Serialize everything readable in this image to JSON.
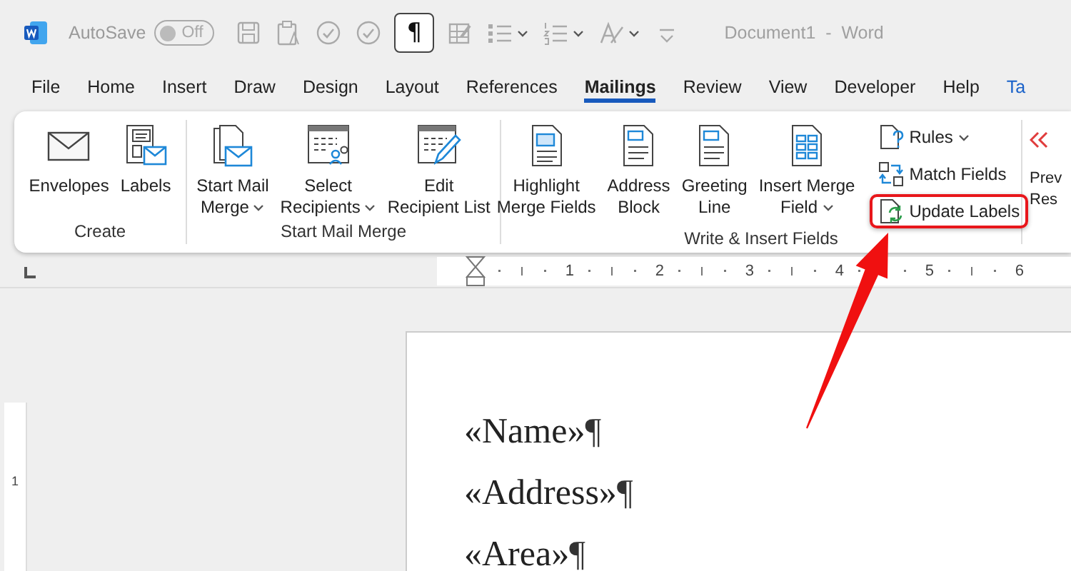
{
  "title_bar": {
    "autosave_label": "AutoSave",
    "autosave_toggle": {
      "label": "Off",
      "on": false
    },
    "tools_left": [
      {
        "kind": "save"
      },
      {
        "kind": "clipboard"
      },
      {
        "kind": "check"
      },
      {
        "kind": "check"
      }
    ],
    "show_marks": {
      "label": "¶",
      "on": true
    },
    "tools_right": [
      {
        "kind": "table",
        "menu": false
      },
      {
        "kind": "bullets",
        "menu": true
      },
      {
        "kind": "numbering",
        "menu": true
      },
      {
        "kind": "styles",
        "menu": true
      },
      {
        "kind": "customize",
        "menu": false
      }
    ],
    "window_title": "Document1  -  Word"
  },
  "tabs": [
    {
      "label": "File",
      "selected": false,
      "contextual": false
    },
    {
      "label": "Home",
      "selected": false,
      "contextual": false
    },
    {
      "label": "Insert",
      "selected": false,
      "contextual": false
    },
    {
      "label": "Draw",
      "selected": false,
      "contextual": false
    },
    {
      "label": "Design",
      "selected": false,
      "contextual": false
    },
    {
      "label": "Layout",
      "selected": false,
      "contextual": false
    },
    {
      "label": "References",
      "selected": false,
      "contextual": false
    },
    {
      "label": "Mailings",
      "selected": true,
      "contextual": false
    },
    {
      "label": "Review",
      "selected": false,
      "contextual": false
    },
    {
      "label": "View",
      "selected": false,
      "contextual": false
    },
    {
      "label": "Developer",
      "selected": false,
      "contextual": false
    },
    {
      "label": "Help",
      "selected": false,
      "contextual": false
    },
    {
      "label": "Ta",
      "selected": false,
      "contextual": true
    }
  ],
  "ribbon": {
    "groups": [
      {
        "label": "Create",
        "buttons": [
          {
            "kind": "large",
            "label": "Envelopes",
            "menu": false,
            "highlighted": false
          },
          {
            "kind": "large",
            "label": "Labels",
            "menu": false,
            "highlighted": false
          }
        ]
      },
      {
        "label": "Start Mail Merge",
        "buttons": [
          {
            "kind": "large",
            "label": "Start Mail\nMerge",
            "menu": true,
            "highlighted": false
          },
          {
            "kind": "large",
            "label": "Select\nRecipients",
            "menu": true,
            "highlighted": false
          },
          {
            "kind": "large",
            "label": "Edit\nRecipient List",
            "menu": false,
            "highlighted": false
          }
        ]
      },
      {
        "label": "Write & Insert Fields",
        "buttons": [
          {
            "kind": "large",
            "label": "Highlight\nMerge Fields",
            "menu": false,
            "highlighted": false
          },
          {
            "kind": "large",
            "label": "Address\nBlock",
            "menu": false,
            "highlighted": false
          },
          {
            "kind": "large",
            "label": "Greeting\nLine",
            "menu": false,
            "highlighted": false
          },
          {
            "kind": "large",
            "label": "Insert Merge\nField",
            "menu": true,
            "highlighted": false
          },
          {
            "kind": "small",
            "label": "Rules",
            "menu": true,
            "highlighted": false
          },
          {
            "kind": "small",
            "label": "Match Fields",
            "menu": false,
            "highlighted": false
          },
          {
            "kind": "small",
            "label": "Update Labels",
            "menu": false,
            "highlighted": true
          }
        ]
      },
      {
        "buttons": [
          {
            "kind": "large",
            "label": "Prev\nRes",
            "menu": false,
            "highlighted": false
          }
        ]
      }
    ]
  },
  "ruler": {
    "numbers": [
      "1",
      "2",
      "3",
      "4",
      "5",
      "6"
    ]
  },
  "vertical_ruler": {
    "numbers": [
      "1"
    ]
  },
  "document": {
    "paragraphs": [
      {
        "text": "«Name»",
        "mark": "¶"
      },
      {
        "text": "«Address»",
        "mark": "¶"
      },
      {
        "text": "«Area»",
        "mark": "¶"
      }
    ]
  }
}
